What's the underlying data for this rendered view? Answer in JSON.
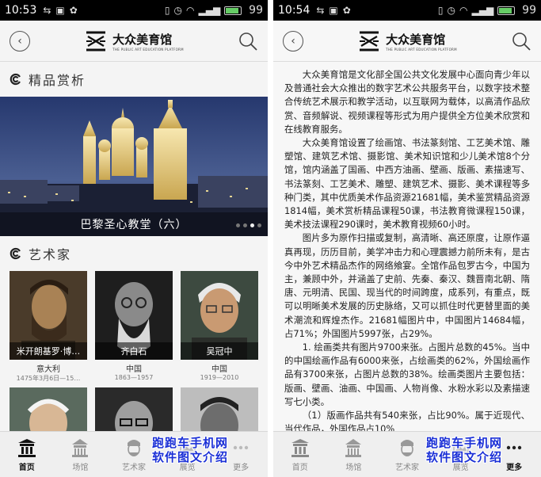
{
  "left": {
    "status": {
      "time": "10:53",
      "battery_level": "99"
    },
    "header": {
      "logo_cn": "大众美育馆",
      "logo_en": "THE PUBLIC ART EDUCATION PLATFORM"
    },
    "featured": {
      "title": "精品赏析",
      "banner_caption": "巴黎圣心教堂（六）",
      "dots": 4,
      "active_dot": 2
    },
    "artists_section": {
      "title": "艺术家"
    },
    "artists": [
      {
        "name": "米开朗基罗·博…",
        "country": "意大利",
        "years": "1475年3月6日—15…"
      },
      {
        "name": "齐白石",
        "country": "中国",
        "years": "1863—1957"
      },
      {
        "name": "吴冠中",
        "country": "中国",
        "years": "1919—2010"
      }
    ],
    "tabs": [
      {
        "label": "首页",
        "icon": "home-pavilion-icon",
        "active": true
      },
      {
        "label": "场馆",
        "icon": "venue-building-icon",
        "active": false
      },
      {
        "label": "艺术家",
        "icon": "artist-portrait-icon",
        "active": false
      },
      {
        "label": "展览",
        "icon": "exhibition-icon",
        "active": false
      },
      {
        "label": "更多",
        "icon": "more-icon",
        "active": false
      }
    ],
    "watermark": {
      "line1": "跑跑车手机网",
      "line2": "软件图文介绍"
    }
  },
  "right": {
    "status": {
      "time": "10:54",
      "battery_level": "99"
    },
    "header": {
      "logo_cn": "大众美育馆",
      "logo_en": "THE PUBLIC ART EDUCATION PLATFORM"
    },
    "article": {
      "paragraphs": [
        "大众美育馆是文化部全国公共文化发展中心面向青少年以及普通社会大众推出的数字艺术公共服务平台，以数字技术整合传统艺术展示和教学活动，以互联网为载体，以高清作品欣赏、音频解说、视频课程等形式为用户提供全方位美术欣赏和在线教育服务。",
        "大众美育馆设置了绘画馆、书法篆刻馆、工艺美术馆、雕塑馆、建筑艺术馆、摄影馆、美术知识馆和少儿美术馆8个分馆，馆内涵盖了国画、中西方油画、壁画、版画、素描速写、书法篆刻、工艺美术、雕塑、建筑艺术、摄影、美术课程等多种门类，其中优质美术作品资源21681幅，美术鉴赏精品资源1814幅，美术赏析精品课程50课，书法教育微课程150课，美术技法课程290课时，美术教育视频60小时。",
        "图片多为原作扫描或复制，高清晰、高还原度，让原作逼真再现，历历目前，美学冲击力和心理震撼力前所未有，是古今中外艺术精品杰作的网络飨宴。全馆作品包罗古今，中国为主，兼顾中外，并涵盖了史前、先秦、秦汉、魏晋南北朝、隋唐、元明清、民国、现当代的时间跨度，成系列，有重点，既可以明晰美术发展的历史脉络，又可以抓住时代更替里面的美术潮流和辉煌杰作。21681幅图片中，中国图片14684幅，占71%；外国图片5997张，占29%。",
        "1. 绘画类共有图片9700来张。占图片总数的45%。当中的中国绘画作品有6000来张，占绘画类的62%，外国绘画作品有3700来张，占图片总数的38%。绘画类图片主要包括：版画、壁画、油画、中国画、人物肖像、水粉水彩以及素描速写七小类。",
        "（1）版画作品共有540来张，占比90%。属于近现代、当代作品，外国作品占10%"
      ]
    },
    "tabs": [
      {
        "label": "首页",
        "icon": "home-pavilion-icon",
        "active": false
      },
      {
        "label": "场馆",
        "icon": "venue-building-icon",
        "active": false
      },
      {
        "label": "艺术家",
        "icon": "artist-portrait-icon",
        "active": false
      },
      {
        "label": "展览",
        "icon": "exhibition-icon",
        "active": false
      },
      {
        "label": "更多",
        "icon": "more-icon",
        "active": true
      }
    ],
    "watermark": {
      "line1": "跑跑车手机网",
      "line2": "软件图文介绍"
    }
  }
}
